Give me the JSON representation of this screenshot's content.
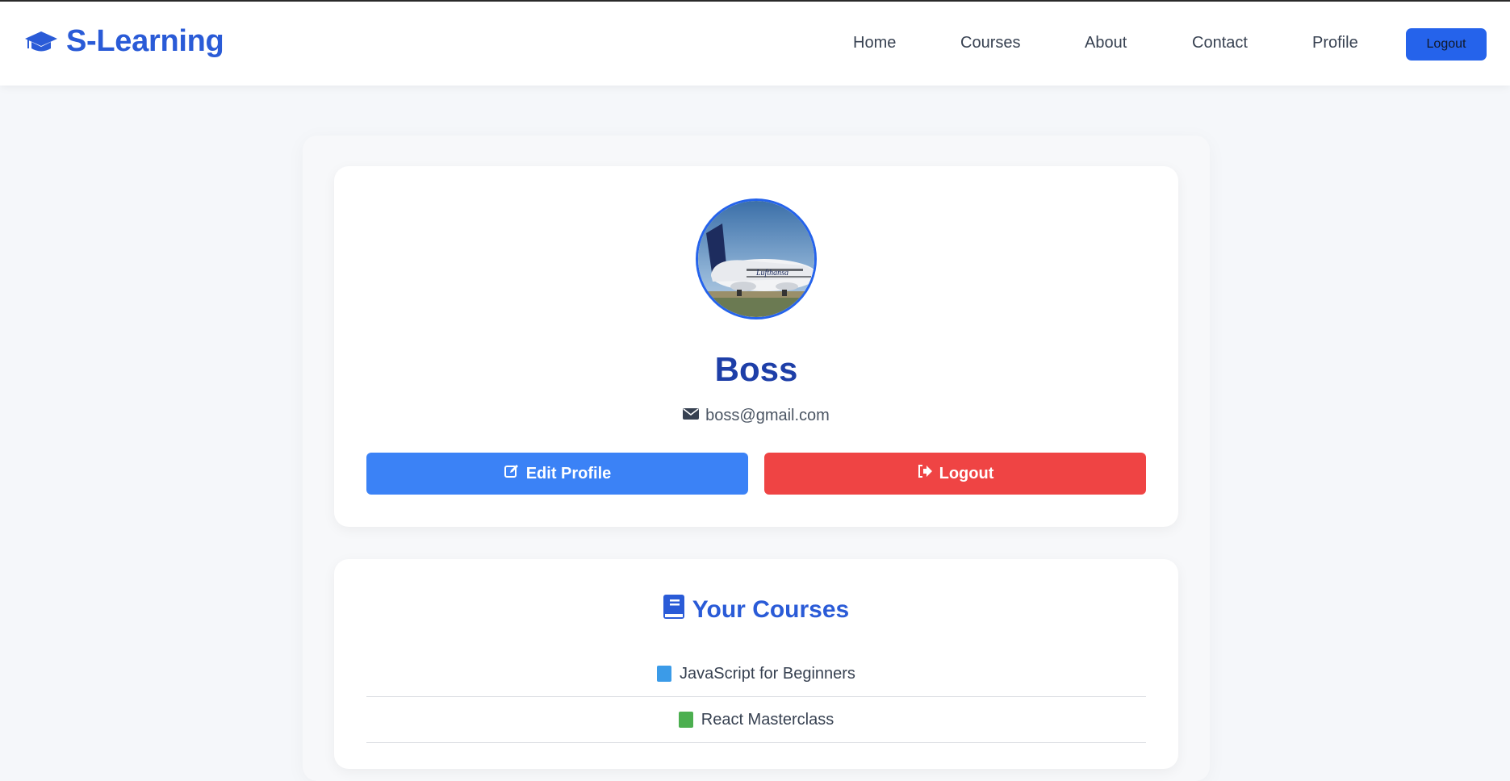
{
  "brand": {
    "name": "S-Learning",
    "icon": "graduation-cap-icon",
    "color": "#2a5bd7"
  },
  "nav": {
    "links": [
      "Home",
      "Courses",
      "About",
      "Contact",
      "Profile"
    ],
    "logout_label": "Logout"
  },
  "profile": {
    "avatar_icon": "airplane-photo",
    "name": "Boss",
    "email": "boss@gmail.com",
    "edit_label": "Edit Profile",
    "logout_label": "Logout"
  },
  "courses": {
    "title": "Your Courses",
    "items": [
      {
        "label": "JavaScript for Beginners",
        "icon": "blue-book-icon",
        "color": "#3b9be8"
      },
      {
        "label": "React Masterclass",
        "icon": "green-book-icon",
        "color": "#4caf50"
      }
    ]
  },
  "colors": {
    "primary": "#2563eb",
    "edit_button": "#3b82f6",
    "logout_button": "#ef4444",
    "heading": "#1e3fa8"
  }
}
